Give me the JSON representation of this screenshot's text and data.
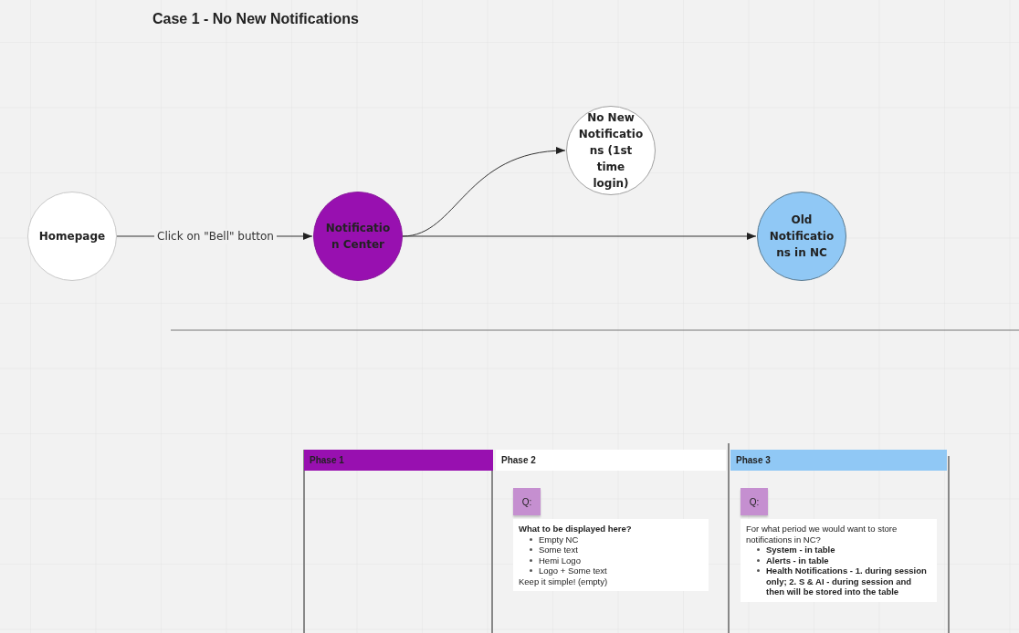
{
  "title": "Case 1 - No New Notifications",
  "nodes": [
    {
      "label": "Homepage",
      "color": "#ffffff"
    },
    {
      "label": "Notificatio n Center",
      "color": "#9810b0"
    },
    {
      "label": "No New Notificatio ns (1st time login)",
      "color": "#ffffff"
    },
    {
      "label": "Old Notificatio ns in NC",
      "color": "#90c8f5"
    }
  ],
  "edges": [
    {
      "kind": "straight",
      "label": "Click on \"Bell\" button"
    },
    {
      "kind": "curve"
    },
    {
      "kind": "straight"
    }
  ],
  "phases": [
    {
      "label": "Phase 1",
      "color": "#9810b0"
    },
    {
      "label": "Phase 2",
      "color": "#ffffff",
      "note": {
        "sticky": "Q:",
        "lines": [
          {
            "kind": "plain",
            "bold": true,
            "text": "What to be displayed here?"
          },
          {
            "kind": "bullet",
            "bold": false,
            "text": "Empty NC"
          },
          {
            "kind": "bullet",
            "bold": false,
            "text": "Some text"
          },
          {
            "kind": "bullet",
            "bold": false,
            "text": "Hemi Logo"
          },
          {
            "kind": "bullet",
            "bold": false,
            "text": "Logo + Some text"
          },
          {
            "kind": "plain",
            "bold": false,
            "text": "Keep it simple! (empty)"
          }
        ]
      }
    },
    {
      "label": "Phase 3",
      "color": "#90c8f5",
      "note": {
        "sticky": "Q:",
        "lines": [
          {
            "kind": "plain",
            "bold": false,
            "text": "For what period we would want to store notifications in NC?"
          },
          {
            "kind": "bullet",
            "bold": true,
            "text": "System - in table"
          },
          {
            "kind": "bullet",
            "bold": true,
            "text": "Alerts - in table"
          },
          {
            "kind": "bullet",
            "bold": true,
            "text": "Health Notifications - 1. during session only; 2. S & AI - during session and then will be stored into the table"
          }
        ]
      }
    }
  ]
}
